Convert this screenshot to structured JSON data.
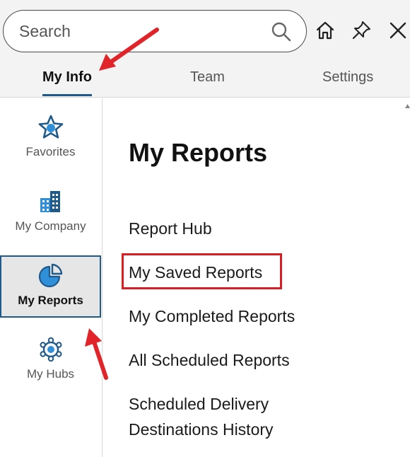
{
  "search": {
    "placeholder": "Search"
  },
  "toolbar_icons": [
    "home-icon",
    "pin-icon",
    "close-icon"
  ],
  "tabs": [
    {
      "label": "My Info",
      "active": true
    },
    {
      "label": "Team",
      "active": false
    },
    {
      "label": "Settings",
      "active": false
    }
  ],
  "sidebar": {
    "items": [
      {
        "label": "Favorites",
        "icon": "star-icon",
        "active": false
      },
      {
        "label": "My Company",
        "icon": "building-icon",
        "active": false
      },
      {
        "label": "My Reports",
        "icon": "pie-chart-icon",
        "active": true
      },
      {
        "label": "My Hubs",
        "icon": "hub-icon",
        "active": false
      }
    ]
  },
  "main": {
    "title": "My Reports",
    "links": [
      "Report Hub",
      "My Saved Reports",
      "My Completed Reports",
      "All Scheduled Reports",
      "Scheduled Delivery",
      "Destinations History"
    ]
  },
  "colors": {
    "accent": "#1f5a8a",
    "icon_blue": "#2f8fd8",
    "highlight_red": "#d81e22",
    "annotation_arrow": "#e0242a"
  }
}
